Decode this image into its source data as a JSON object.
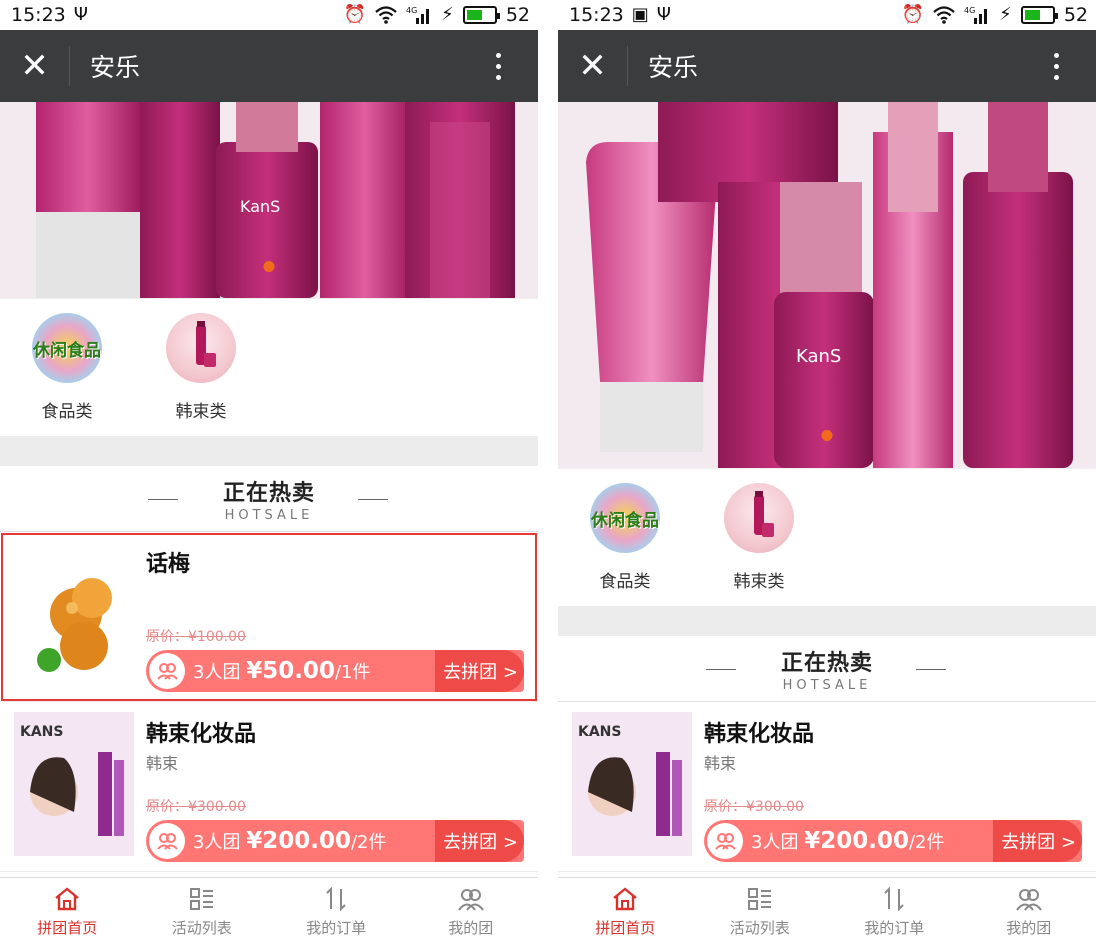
{
  "left": {
    "status": {
      "time": "15:23",
      "signal_label": "4G",
      "battery": "52"
    },
    "title": "安乐",
    "categories": [
      {
        "label": "食品类",
        "badge": "休闲食品"
      },
      {
        "label": "韩束类"
      }
    ],
    "section": {
      "title": "正在热卖",
      "subtitle": "HOTSALE"
    },
    "products": [
      {
        "name": "话梅",
        "brand": "",
        "original_price": "原价：¥100.00",
        "group_size": "3人团 ",
        "price": "¥50.00",
        "unit": "/1件",
        "join_label": "去拼团 >"
      },
      {
        "name": "韩束化妆品",
        "brand": "韩束",
        "original_price": "原价：¥300.00",
        "group_size": "3人团 ",
        "price": "¥200.00",
        "unit": "/2件",
        "join_label": "去拼团 >"
      }
    ],
    "nav": [
      {
        "label": "拼团首页"
      },
      {
        "label": "活动列表"
      },
      {
        "label": "我的订单"
      },
      {
        "label": "我的团"
      }
    ]
  },
  "right": {
    "status": {
      "time": "15:23",
      "signal_label": "4G",
      "battery": "52"
    },
    "title": "安乐",
    "categories": [
      {
        "label": "食品类",
        "badge": "休闲食品"
      },
      {
        "label": "韩束类"
      }
    ],
    "section": {
      "title": "正在热卖",
      "subtitle": "HOTSALE"
    },
    "products": [
      {
        "name": "韩束化妆品",
        "brand": "韩束",
        "original_price": "原价：¥300.00",
        "group_size": "3人团 ",
        "price": "¥200.00",
        "unit": "/2件",
        "join_label": "去拼团 >"
      }
    ],
    "nav": [
      {
        "label": "拼团首页"
      },
      {
        "label": "活动列表"
      },
      {
        "label": "我的订单"
      },
      {
        "label": "我的团"
      }
    ]
  },
  "banner_brand": "KanS",
  "product_image_brand": "KANS",
  "colors": {
    "title_bar": "#3b3c3e",
    "accent": "#d9322c",
    "group_bar": "#ff7674",
    "join_button": "#ee4a47",
    "banner_dot": "#f26b1d"
  }
}
